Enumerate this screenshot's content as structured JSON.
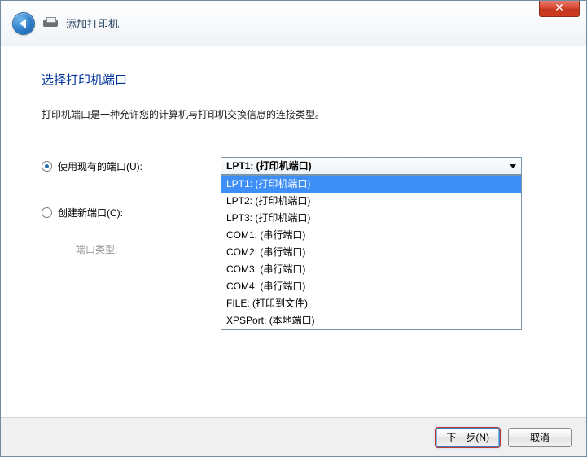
{
  "titlebar": {
    "close_glyph": "✕"
  },
  "header": {
    "title": "添加打印机"
  },
  "content": {
    "heading": "选择打印机端口",
    "description": "打印机端口是一种允许您的计算机与打印机交换信息的连接类型。"
  },
  "port": {
    "use_existing_label": "使用现有的端口(U):",
    "create_new_label": "创建新端口(C):",
    "port_type_label": "端口类型:",
    "selected_value": "LPT1: (打印机端口)",
    "options": [
      "LPT1: (打印机端口)",
      "LPT2: (打印机端口)",
      "LPT3: (打印机端口)",
      "COM1: (串行端口)",
      "COM2: (串行端口)",
      "COM3: (串行端口)",
      "COM4: (串行端口)",
      "FILE: (打印到文件)",
      "XPSPort: (本地端口)"
    ]
  },
  "footer": {
    "next_label": "下一步(N)",
    "cancel_label": "取消"
  }
}
